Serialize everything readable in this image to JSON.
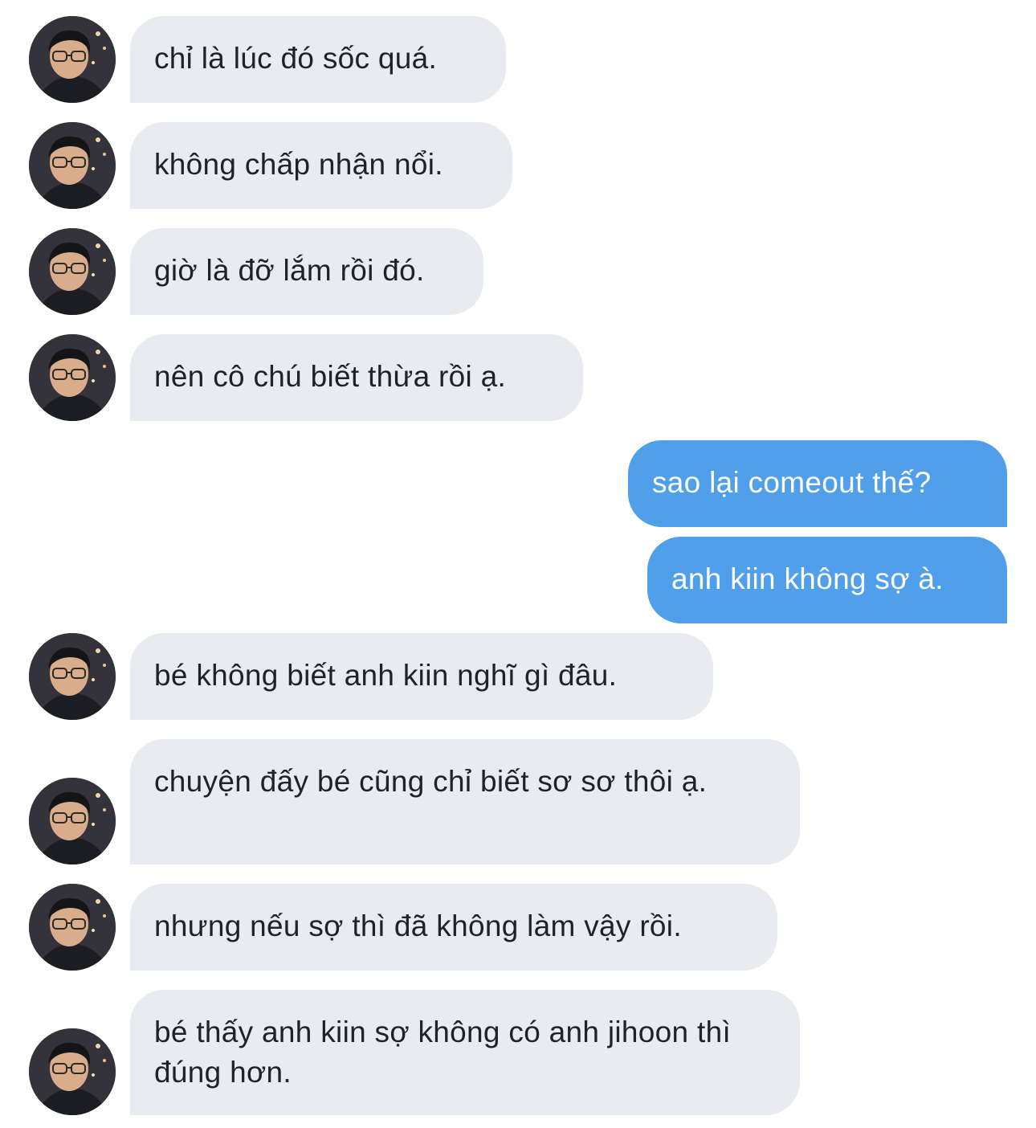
{
  "thread": {
    "messages": [
      {
        "from": "them",
        "text": "chỉ là lúc đó sốc quá."
      },
      {
        "from": "them",
        "text": "không chấp nhận nổi."
      },
      {
        "from": "them",
        "text": "giờ là đỡ lắm rồi đó."
      },
      {
        "from": "them",
        "text": "nên cô chú biết thừa rồi ạ."
      },
      {
        "from": "me",
        "text": "sao lại comeout thế?"
      },
      {
        "from": "me",
        "text": "anh kiin không sợ à."
      },
      {
        "from": "them",
        "text": "bé không biết anh kiin nghĩ gì đâu."
      },
      {
        "from": "them",
        "text": "chuyện đấy bé cũng chỉ biết sơ sơ thôi ạ."
      },
      {
        "from": "them",
        "text": "nhưng nếu sợ thì đã không làm vậy rồi."
      },
      {
        "from": "them",
        "text": "bé thấy anh kiin sợ không có anh jihoon thì đúng hơn."
      }
    ]
  },
  "colors": {
    "incoming_bubble": "#e8ecf0",
    "outgoing_bubble": "#4f9fea",
    "incoming_text": "#1f2328",
    "outgoing_text": "#ffffff"
  },
  "icons": {
    "avatar": "person-avatar-icon"
  }
}
